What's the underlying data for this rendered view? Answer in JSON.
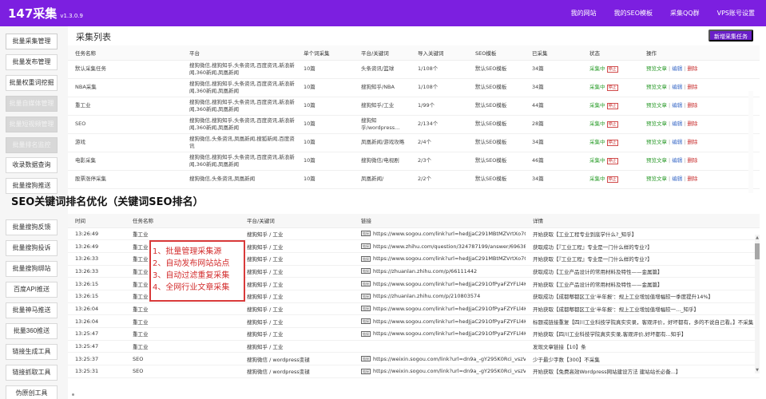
{
  "brand": {
    "name": "147采集",
    "version": "v1.3.0.9"
  },
  "nav": [
    "我的网站",
    "我的SEO模板",
    "采集QQ群",
    "VPS账号设置"
  ],
  "sidebar": [
    "批量采集管理",
    "批量发布管理",
    "批量权重词挖掘",
    "批量自媒体管理",
    "批量短视频管理",
    "批量排名监控",
    "收录数据查询",
    "批量搜狗推送",
    "",
    "批量搜狗反馈",
    "批量搜狗投诉",
    "批量搜狗绑站",
    "百度API推送",
    "批量神马推送",
    "批量360推送",
    "链接生成工具",
    "链接抓取工具",
    "伪原创工具"
  ],
  "header": {
    "title": "采集列表",
    "new_task": "新增采集任务"
  },
  "tasks": {
    "headers": [
      "任务名称",
      "平台",
      "单个词采集",
      "平台/关键词",
      "导入关键词",
      "SEO模板",
      "已采集",
      "状态",
      "操作"
    ],
    "status_label": "采集中",
    "stop_label": "停止",
    "ops": [
      "预览文章",
      "编辑",
      "删除"
    ],
    "rows": [
      [
        "默认采集任务",
        "搜狗微信,搜狗知乎,头条资讯,百度资讯,新浪新闻,360新闻,凤凰新闻",
        "10篇",
        "头条资讯/篮球",
        "1/108个",
        "默认SEO模板",
        "34篇"
      ],
      [
        "NBA采集",
        "搜狗微信,搜狗知乎,头条资讯,百度资讯,新浪新闻,360新闻,凤凰新闻",
        "10篇",
        "搜狗知乎/NBA",
        "1/108个",
        "默认SEO模板",
        "34篇"
      ],
      [
        "重工业",
        "搜狗微信,搜狗知乎,头条资讯,百度资讯,新浪新闻,360新闻,凤凰新闻",
        "10篇",
        "搜狗知乎/工业",
        "1/99个",
        "默认SEO模板",
        "44篇"
      ],
      [
        "SEO",
        "搜狗微信,搜狗知乎,头条资讯,百度资讯,新浪新闻,360新闻,凤凰新闻",
        "10篇",
        "搜狗知乎/wordpress...",
        "2/134个",
        "默认SEO模板",
        "28篇"
      ],
      [
        "游戏",
        "搜狗微信,头条资讯,凤凰新闻,搜狐新闻,百度资讯",
        "10篇",
        "凤凰新闻/游戏攻略",
        "2/4个",
        "默认SEO模板",
        "34篇"
      ],
      [
        "电影采集",
        "搜狗微信,搜狗知乎,头条资讯,百度资讯,新浪新闻,360新闻,凤凰新闻",
        "10篇",
        "搜狗微信/电视剧",
        "2/3个",
        "默认SEO模板",
        "46篇"
      ],
      [
        "股票涨停采集",
        "搜狗微信,头条资讯,凤凰新闻",
        "10篇",
        "凤凰新闻/",
        "2/2个",
        "默认SEO模板",
        "34篇"
      ]
    ]
  },
  "seo_heading": "SEO关键词排名优化（关键词SEO排名）",
  "logs": {
    "headers": [
      "时间",
      "任务名称",
      "平台/关键词",
      "链接",
      "详情"
    ],
    "link_tag": "链接",
    "rows": [
      [
        "13:26:49",
        "重工业",
        "搜狗知乎 / 工业",
        "https://www.sogou.com/link?url=hedJjaC291MBtMZVrtXo7Cqjl0tE6...",
        "开始获取【工业工程专业到底学什么?_知乎】"
      ],
      [
        "13:26:49",
        "重工业",
        "搜狗知乎 / 工业",
        "https://www.zhihu.com/question/324787199/answer/696381922",
        "获取成功【『工业工程』专业是一门什么样的专业?】"
      ],
      [
        "13:26:33",
        "重工业",
        "搜狗知乎 / 工业",
        "https://www.sogou.com/link?url=hedJjaC291MBtMZVrtXo7Cqjl0tE6...",
        "开始获取【『工业工程』专业是一门什么样的专业?】"
      ],
      [
        "13:26:33",
        "重工业",
        "搜狗知乎 / 工业",
        "https://zhuanlan.zhihu.com/p/66111442",
        "获取成功【工业产品设计的常用材料及特性——金属篇】"
      ],
      [
        "13:26:15",
        "重工业",
        "搜狗知乎 / 工业",
        "https://www.sogou.com/link?url=hedJjaC291OfPyaFZYFLl4KQWvqf...",
        "开始获取【工业产品设计的常用材料及特性——金属篇】"
      ],
      [
        "13:26:15",
        "重工业",
        "搜狗知乎 / 工业",
        "https://zhuanlan.zhihu.com/p/210803574",
        "获取成功【成都郫都区工业'半年报'：规上工业增加值增幅较一季度提升14%】"
      ],
      [
        "13:26:04",
        "重工业",
        "搜狗知乎 / 工业",
        "https://www.sogou.com/link?url=hedJjaC291OfPyaFZYFLl4KQWvqf...",
        "开始获取【成都郫都区工业'半年报'：规上工业增加值增幅较一..._知乎】"
      ],
      [
        "13:26:04",
        "重工业",
        "搜狗知乎 / 工业",
        "https://www.sogou.com/link?url=hedJjaC291OfPyaFZYFLl4KQWvqf...",
        "标题或链接重复【四川工业科技学院真实实录，客观评价，好坏都有，多的不说自己看。】不采集"
      ],
      [
        "13:25:47",
        "重工业",
        "搜狗知乎 / 工业",
        "https://www.sogou.com/link?url=hedJjaC291OfPyaFZYFLl4KQWvqf...",
        "开始获取【四川工业科技学院真实实录,客观评价,好坏都有...知乎】"
      ],
      [
        "13:25:47",
        "重工业",
        "搜狗知乎 / 工业",
        "",
        "发现文章链接【10】条"
      ],
      [
        "13:25:37",
        "SEO",
        "搜狗微信 / wordpress变褪",
        "https://weixin.sogou.com/link?url=dn9a_-gY295K0Rci_vszVXfdMS...",
        "少于最少字数【300】不采集"
      ],
      [
        "13:25:31",
        "SEO",
        "搜狗微信 / wordpress变褪",
        "https://weixin.sogou.com/link?url=dn9a_-gY295K0Rci_vszVXfdMS...",
        "开始获取【免费高效Wordpress网站建设方法 建站站长必备...】"
      ]
    ]
  },
  "overlay": [
    "1、批量管理采集源",
    "2、自动发布网站站点",
    "3、自动过滤重复采集",
    "4、全网行业文章采集"
  ],
  "colors": {
    "topbar": "#7c1fe0",
    "accent": "#6a1fc8",
    "overlay": "#d93a3a"
  }
}
